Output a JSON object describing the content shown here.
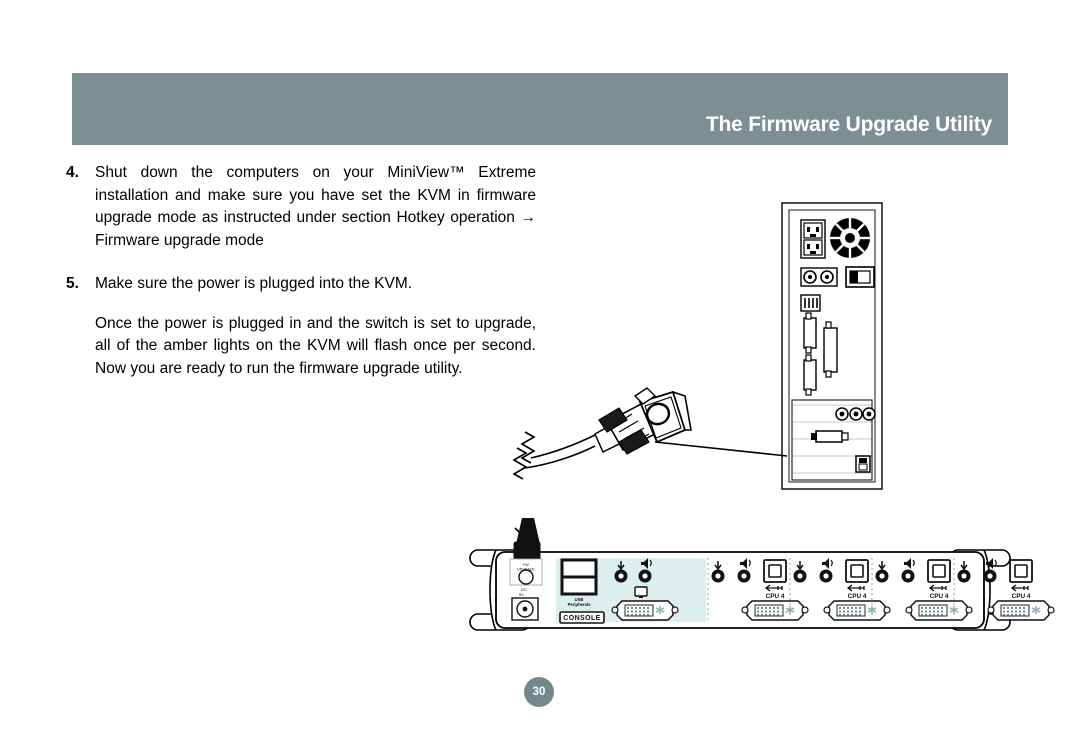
{
  "header": {
    "title": "The Firmware Upgrade Utility",
    "banner_color": "#7c9093"
  },
  "content": {
    "items": [
      {
        "number": "4.",
        "text": "Shut down the computers on your MiniView™ Extreme installation and make sure you have set the KVM in firmware upgrade mode as instructed under section Hotkey operation → Firmware upgrade mode"
      },
      {
        "number": "5.",
        "text": "Make sure the power is plugged into the KVM."
      }
    ],
    "closing_paragraph": "Once the power is plugged in and the switch is set to upgrade, all of the amber lights on the KVM will flash once per second. Now you are ready to run the firmware upgrade utility."
  },
  "footer": {
    "page_number": "30",
    "badge_color": "#72888b"
  },
  "illustration": {
    "kvm": {
      "console_panel_color": "#dcefee",
      "console_badge": "CONSOLE",
      "usb_peripherals_label": "USB Peripherals",
      "fw_upgrade_label": "FW UPGRADE",
      "power_label": "DC 5V",
      "cpu_ports": [
        {
          "label": "CPU 4"
        },
        {
          "label": "CPU 4"
        },
        {
          "label": "CPU 4"
        },
        {
          "label": "CPU 4"
        }
      ],
      "usb_icon_label": "USB"
    },
    "tower": {
      "description": "computer rear panel"
    }
  }
}
